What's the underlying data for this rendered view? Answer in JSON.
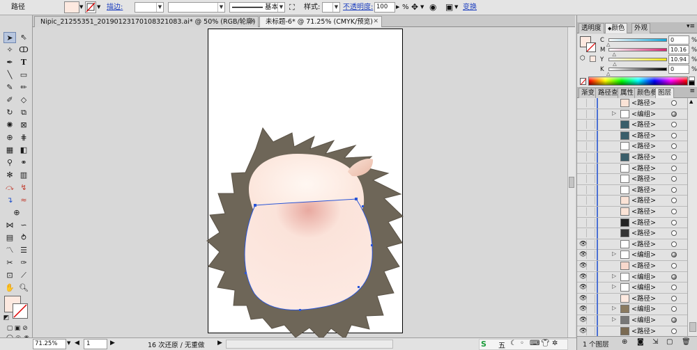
{
  "control_bar": {
    "label": "路径",
    "stroke_label": "描边:",
    "stroke_style": "基本",
    "style_label": "样式:",
    "opacity_label": "不透明度:",
    "opacity_value": "100",
    "opacity_unit": "%",
    "transform_label": "变换",
    "fill_color": "#fde9e0"
  },
  "tabs": [
    {
      "label": "Nipic_21255351_20190123170108321083.ai* @ 50% (RGB/轮廓)",
      "active": false
    },
    {
      "label": "未标题-6* @ 71.25% (CMYK/预览)",
      "active": true
    }
  ],
  "status_bar": {
    "zoom": "71.25%",
    "page": "1",
    "history": "16 次还原 / 无重做"
  },
  "color_panel": {
    "tabs": [
      "透明度",
      "颜色",
      "外观"
    ],
    "active_tab": "颜色",
    "channels": [
      {
        "label": "C",
        "value": "0",
        "color": "#16a6d9",
        "level": 0
      },
      {
        "label": "M",
        "value": "10.16",
        "color": "#d6266f",
        "level": 0.1016
      },
      {
        "label": "Y",
        "value": "10.94",
        "color": "#f3e516",
        "level": 0.1094
      },
      {
        "label": "K",
        "value": "0",
        "color": "#000000",
        "level": 0
      }
    ],
    "unit": "%"
  },
  "layers_panel": {
    "tabs": [
      "渐变",
      "路径查",
      "属性",
      "颜色参",
      "图层"
    ],
    "active_tab": "图层",
    "rows": [
      {
        "name": "<路径>",
        "eye": false,
        "tri": false,
        "thumb": "#fbe3d6",
        "filled": false
      },
      {
        "name": "<编组>",
        "eye": false,
        "tri": true,
        "thumb": "#ffffff",
        "filled": true
      },
      {
        "name": "<路径>",
        "eye": false,
        "tri": false,
        "thumb": "#3a5e6a",
        "filled": false
      },
      {
        "name": "<路径>",
        "eye": false,
        "tri": false,
        "thumb": "#3a5e6a",
        "filled": false
      },
      {
        "name": "<路径>",
        "eye": false,
        "tri": false,
        "thumb": "#ffffff",
        "filled": false
      },
      {
        "name": "<路径>",
        "eye": false,
        "tri": false,
        "thumb": "#3a5e6a",
        "filled": false
      },
      {
        "name": "<路径>",
        "eye": false,
        "tri": false,
        "thumb": "#ffffff",
        "filled": false
      },
      {
        "name": "<路径>",
        "eye": false,
        "tri": false,
        "thumb": "#ffffff",
        "filled": false
      },
      {
        "name": "<路径>",
        "eye": false,
        "tri": false,
        "thumb": "#ffffff",
        "filled": false
      },
      {
        "name": "<路径>",
        "eye": false,
        "tri": false,
        "thumb": "#fbe3d6",
        "filled": false
      },
      {
        "name": "<路径>",
        "eye": false,
        "tri": false,
        "thumb": "#fbe3d6",
        "filled": false
      },
      {
        "name": "<路径>",
        "eye": false,
        "tri": false,
        "thumb": "#222222",
        "filled": false
      },
      {
        "name": "<路径>",
        "eye": false,
        "tri": false,
        "thumb": "#333333",
        "filled": false
      },
      {
        "name": "<路径>",
        "eye": true,
        "tri": false,
        "thumb": "#ffffff",
        "filled": false
      },
      {
        "name": "<编组>",
        "eye": true,
        "tri": true,
        "thumb": "#ffffff",
        "filled": true
      },
      {
        "name": "<路径>",
        "eye": true,
        "tri": false,
        "thumb": "#f7d8cc",
        "filled": false
      },
      {
        "name": "<编组>",
        "eye": true,
        "tri": true,
        "thumb": "#ffffff",
        "filled": true
      },
      {
        "name": "<编组>",
        "eye": true,
        "tri": true,
        "thumb": "#ffffff",
        "filled": false
      },
      {
        "name": "<路径>",
        "eye": true,
        "tri": false,
        "thumb": "#fde9e0",
        "filled": false
      },
      {
        "name": "<编组>",
        "eye": true,
        "tri": true,
        "thumb": "#8a7a60",
        "filled": false
      },
      {
        "name": "<编组>",
        "eye": true,
        "tri": true,
        "thumb": "#777777",
        "filled": true
      },
      {
        "name": "<路径>",
        "eye": true,
        "tri": false,
        "thumb": "#7a6a52",
        "filled": false
      }
    ],
    "footer": "1 个图层"
  }
}
